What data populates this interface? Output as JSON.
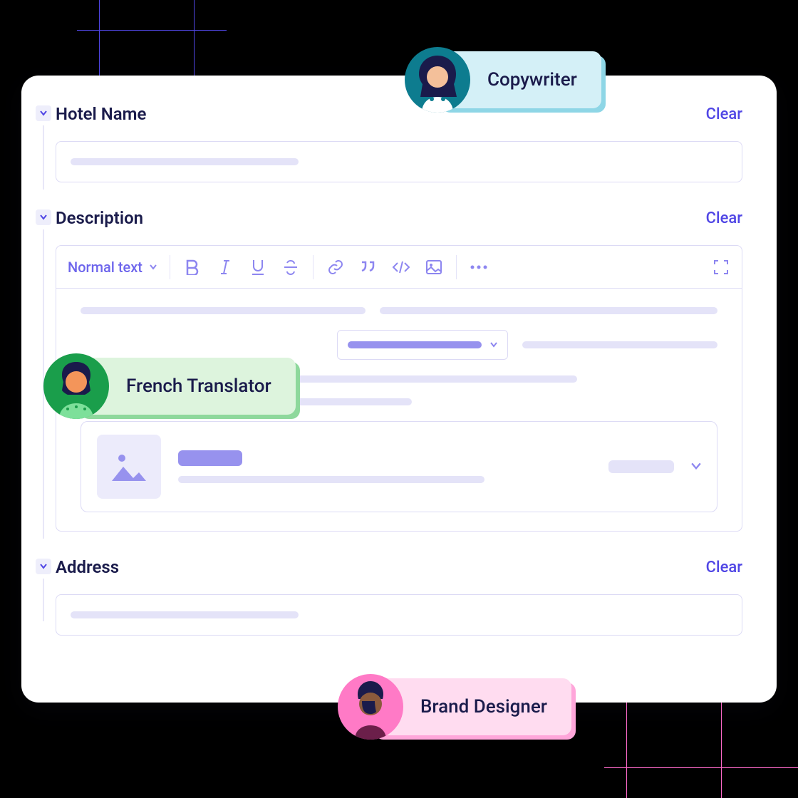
{
  "fields": {
    "hotel_name": {
      "label": "Hotel Name",
      "clear": "Clear"
    },
    "description": {
      "label": "Description",
      "clear": "Clear"
    },
    "address": {
      "label": "Address",
      "clear": "Clear"
    }
  },
  "toolbar": {
    "format": "Normal text"
  },
  "roles": {
    "copywriter": "Copywriter",
    "translator": "French Translator",
    "designer": "Brand Designer"
  },
  "colors": {
    "primary": "#5046e5",
    "text": "#1a1b4b",
    "teal": "#d4f0f7",
    "green": "#ddf4dd",
    "pink": "#ffdcf0"
  }
}
